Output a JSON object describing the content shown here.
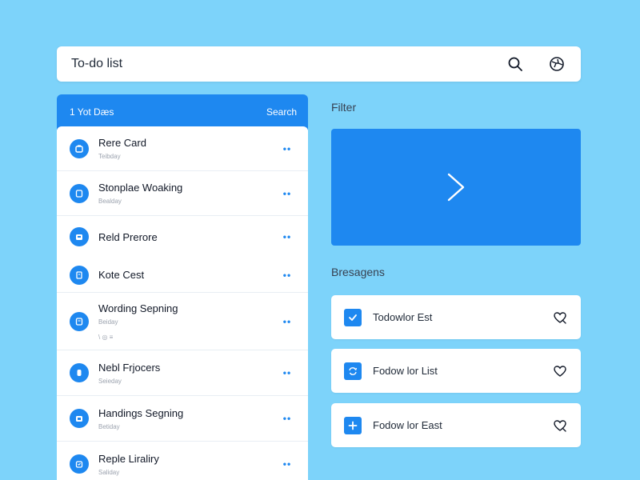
{
  "topbar": {
    "title": "To-do list",
    "search_icon": "search-icon",
    "globe_icon": "globe-icon"
  },
  "panel": {
    "header_left": "1 Yot Dæs",
    "header_right": "Search",
    "items": [
      {
        "name": "Rere Card",
        "sub": "Teibday",
        "extra": ""
      },
      {
        "name": "Stonplae Woaking",
        "sub": "Bealday",
        "extra": ""
      },
      {
        "name": "Reld Prerore",
        "sub": "",
        "extra": ""
      },
      {
        "name": "Kote Cest",
        "sub": "",
        "extra": ""
      },
      {
        "name": "Wording Sepning",
        "sub": "Beiday",
        "extra": "\\ ◎ ≡"
      },
      {
        "name": "Nebl Frjocers",
        "sub": "Seieday",
        "extra": ""
      },
      {
        "name": "Handings Segning",
        "sub": "Betiday",
        "extra": ""
      },
      {
        "name": "Reple Liraliry",
        "sub": "Saliday",
        "extra": ""
      }
    ]
  },
  "right": {
    "filter_label": "Filter",
    "hero_icon": "chevron-right-icon",
    "section_label": "Bresagens",
    "cards": [
      {
        "label": "Todowlor Est",
        "icon": "check-icon",
        "action_icon": "heart-search-icon"
      },
      {
        "label": "Fodow lor List",
        "icon": "sync-icon",
        "action_icon": "heart-icon"
      },
      {
        "label": "Fodow lor East",
        "icon": "plus-icon",
        "action_icon": "heart-search-icon"
      }
    ]
  },
  "colors": {
    "background": "#7dd3fa",
    "accent": "#1e88f0",
    "surface": "#ffffff"
  }
}
